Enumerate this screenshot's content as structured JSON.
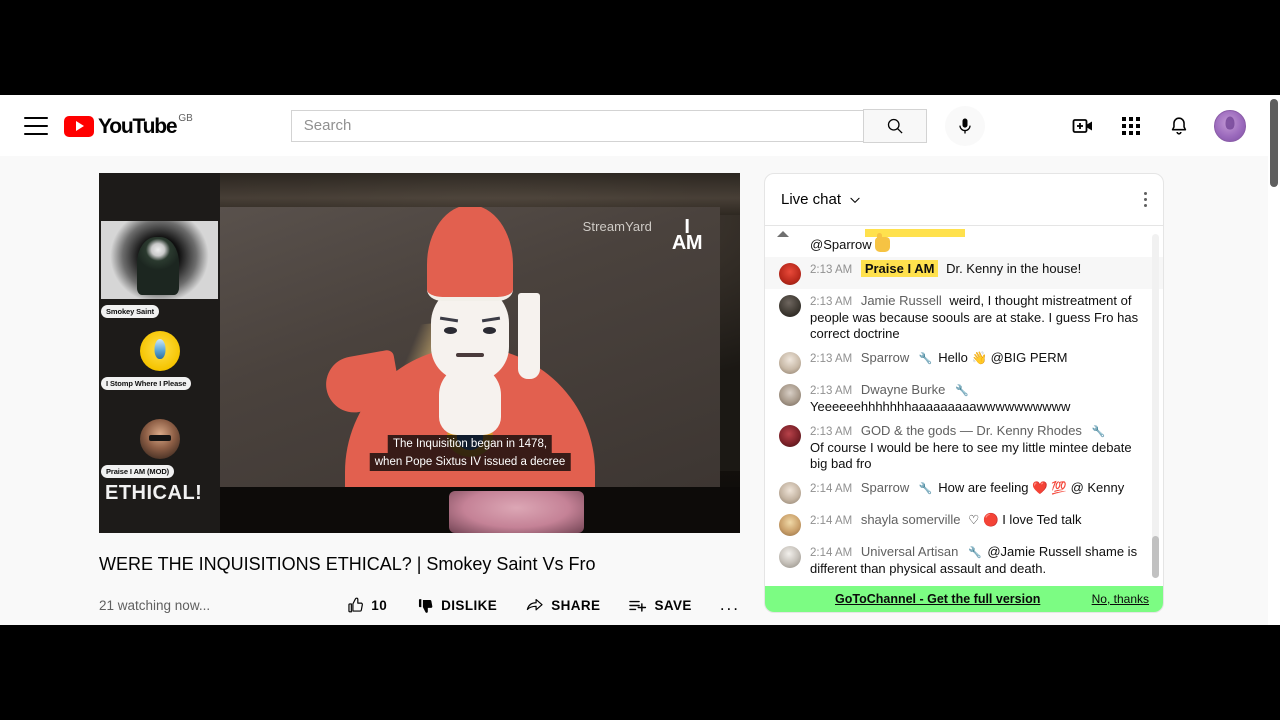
{
  "masthead": {
    "menu_icon": "hamburger-icon",
    "logo_text": "YouTube",
    "logo_country": "GB",
    "search_placeholder": "Search",
    "search_value": "",
    "search_icon": "search-icon",
    "mic_icon": "microphone-icon",
    "create_icon": "create-video-icon",
    "apps_icon": "apps-grid-icon",
    "notifications_icon": "notifications-bell-icon",
    "avatar_icon": "account-avatar"
  },
  "player": {
    "watermark": "StreamYard",
    "watermark_bold_part": "Yard",
    "overlay_logo_line1": "I",
    "overlay_logo_line2": "AM",
    "rail_word": "ETHICAL!",
    "participants": [
      {
        "name": "Smokey Saint"
      },
      {
        "name": "I Stomp Where I Please"
      },
      {
        "name": "Praise I AM (MOD)"
      }
    ],
    "captions": [
      "The Inquisition began in 1478,",
      "when Pope Sixtus IV issued a decree"
    ]
  },
  "video": {
    "title": "WERE THE INQUISITIONS ETHICAL? | Smokey Saint Vs Fro",
    "watching": "21 watching now...",
    "like_count": "10",
    "like_icon": "thumbs-up-icon",
    "dislike_label": "DISLIKE",
    "dislike_icon": "thumbs-down-icon",
    "share_label": "SHARE",
    "share_icon": "share-arrow-icon",
    "save_label": "SAVE",
    "save_icon": "save-playlist-icon",
    "more_label": "..."
  },
  "chat": {
    "title": "Live chat",
    "chevron_icon": "chevron-down-icon",
    "kebab_icon": "more-vertical-icon",
    "messages": [
      {
        "time": "",
        "author": "",
        "text": "@Sparrow",
        "badge": "none",
        "clipped": true
      },
      {
        "time": "2:13 AM",
        "author": "Praise I AM",
        "text": "Dr. Kenny in the house!",
        "badge": "highlight"
      },
      {
        "time": "2:13 AM",
        "author": "Jamie Russell",
        "text": "weird, I thought mistreatment of people was because soouls are at stake. I guess Fro has correct doctrine",
        "badge": "none"
      },
      {
        "time": "2:13 AM",
        "author": "Sparrow",
        "text": "Hello",
        "text_after": "@BIG PERM",
        "badge": "moderator"
      },
      {
        "time": "2:13 AM",
        "author": "Dwayne Burke",
        "text": "Yeeeeeehhhhhhhaaaaaaaaawwwwwwwwww",
        "badge": "moderator"
      },
      {
        "time": "2:13 AM",
        "author": "GOD & the gods — Dr. Kenny Rhodes",
        "text": "Of course I would be here to see my little mintee debate big bad fro",
        "badge": "moderator"
      },
      {
        "time": "2:14 AM",
        "author": "Sparrow",
        "text": "How are feeling",
        "text_after": "@ Kenny",
        "badge": "moderator"
      },
      {
        "time": "2:14 AM",
        "author": "shayla somerville",
        "text": "I love Ted talk",
        "badge": "member"
      },
      {
        "time": "2:14 AM",
        "author": "Universal Artisan",
        "text": "@Jamie Russell shame is different than physical assault and death.",
        "badge": "moderator"
      }
    ],
    "promo": {
      "title": "GoToChannel - Get the full version",
      "dismiss": "No, thanks"
    }
  },
  "colors": {
    "youtube_red": "#ff0000",
    "highlight_yellow": "#ffe14d",
    "promo_green": "#7cfc83",
    "moderator_blue": "#2f7fd4"
  }
}
